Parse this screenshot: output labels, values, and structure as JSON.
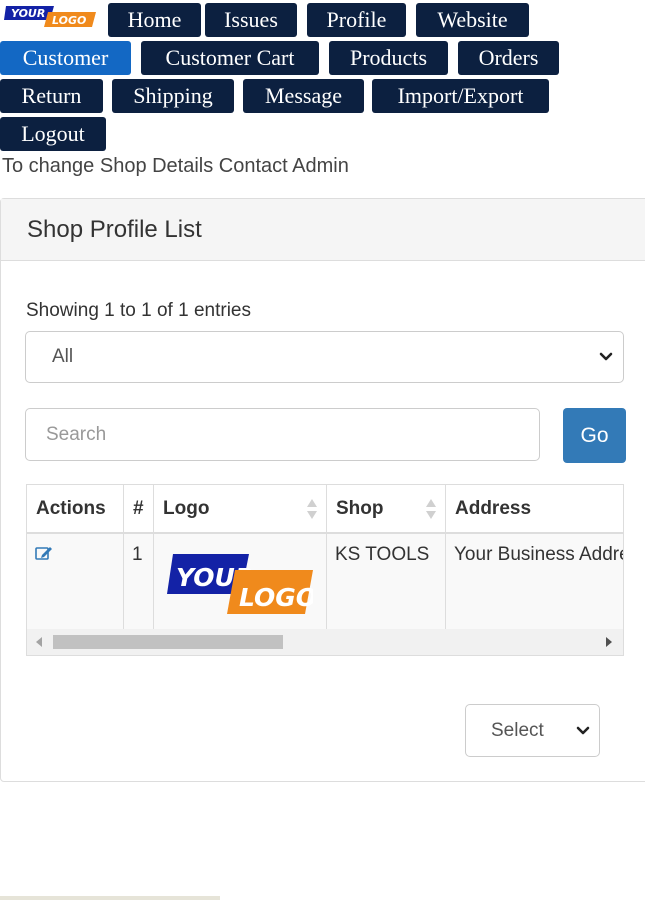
{
  "brand": {
    "logo_top": "YOUR",
    "logo_bottom": "LOGO"
  },
  "nav": {
    "items": [
      {
        "label": "Home"
      },
      {
        "label": "Issues"
      },
      {
        "label": "Profile"
      },
      {
        "label": "Website"
      },
      {
        "label": "Customer",
        "active": true
      },
      {
        "label": "Customer Cart"
      },
      {
        "label": "Products"
      },
      {
        "label": "Orders"
      },
      {
        "label": "Return"
      },
      {
        "label": "Shipping"
      },
      {
        "label": "Message"
      },
      {
        "label": "Import/Export"
      },
      {
        "label": "Logout"
      }
    ]
  },
  "notice": "To change Shop Details Contact Admin",
  "panel": {
    "title": "Shop Profile List",
    "entries_info": "Showing 1 to 1 of 1 entries",
    "length_select": {
      "value": "All"
    },
    "search": {
      "placeholder": "Search",
      "value": "",
      "go_label": "Go"
    }
  },
  "table": {
    "columns": [
      "Actions",
      "#",
      "Logo",
      "Shop",
      "Address"
    ],
    "rows": [
      {
        "index": "1",
        "logo_top": "YOUR",
        "logo_bottom": "LOGO",
        "shop": "KS TOOLS",
        "address": "Your Business Address"
      }
    ]
  },
  "pagination": {
    "select_value": "Select"
  },
  "colors": {
    "nav_bg": "#0c2040",
    "nav_active": "#1368c4",
    "primary_button": "#337ab7",
    "logo_blue": "#1322a6",
    "logo_orange": "#f08a1c"
  },
  "icons": {
    "edit": "edit-icon",
    "dropdown": "chevron-down-icon",
    "sort": "sort-icon"
  }
}
